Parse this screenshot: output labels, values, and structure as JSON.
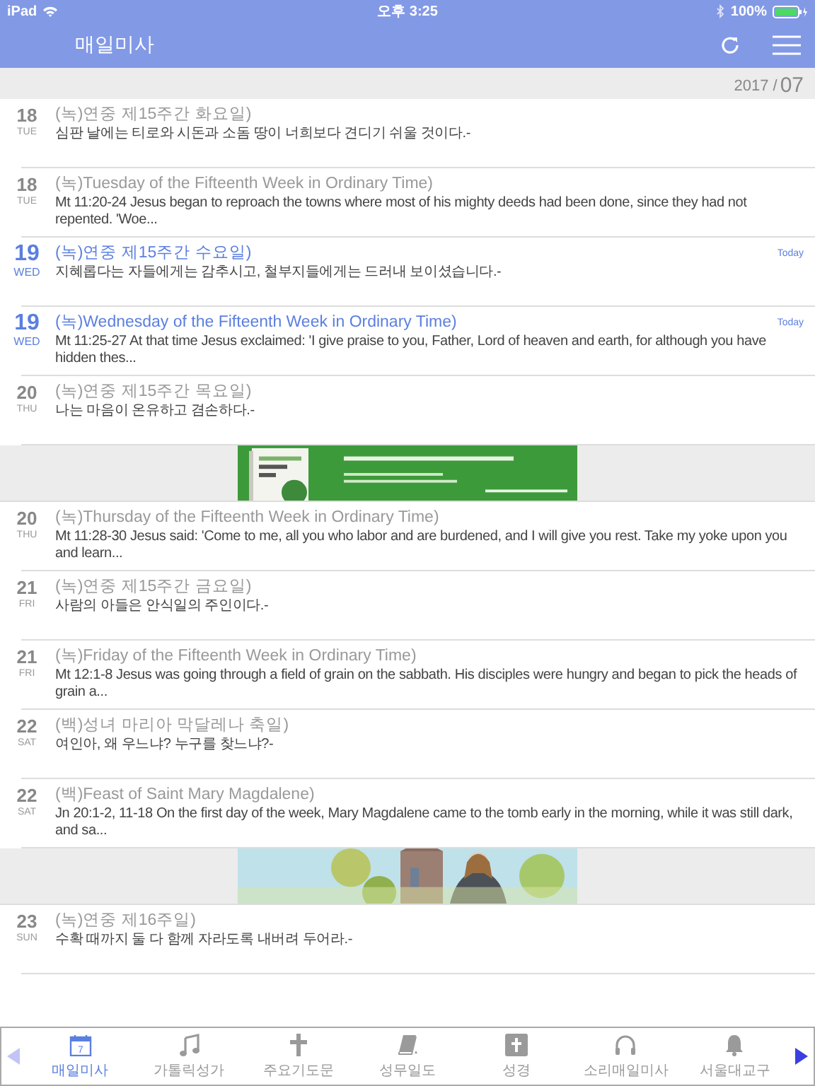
{
  "status_bar": {
    "device": "iPad",
    "time": "오후 3:25",
    "battery": "100%"
  },
  "nav": {
    "title": "매일미사"
  },
  "month_header": {
    "year": "2017 /",
    "month": "07"
  },
  "rows": [
    {
      "kind": "entry",
      "date": "18",
      "weekday": "TUE",
      "title": "(녹)연중 제15주간 화요일)",
      "snippet": "심판 날에는 티로와 시돈과 소돔 땅이 너희보다 견디기 쉬울 것이다.-",
      "today": false
    },
    {
      "kind": "entry",
      "date": "18",
      "weekday": "TUE",
      "title": "(녹)Tuesday of the Fifteenth Week in Ordinary Time)",
      "snippet": "Mt 11:20-24 Jesus began to reproach the towns where most of his mighty deeds had been done, since they had not repented. 'Woe...",
      "today": false
    },
    {
      "kind": "entry",
      "date": "19",
      "weekday": "WED",
      "title": "(녹)연중 제15주간 수요일)",
      "snippet": "지혜롭다는 자들에게는 감추시고, 철부지들에게는 드러내 보이셨습니다.-",
      "today": true,
      "badge": "Today"
    },
    {
      "kind": "entry",
      "date": "19",
      "weekday": "WED",
      "title": "(녹)Wednesday of the Fifteenth Week in Ordinary Time)",
      "snippet": "Mt 11:25-27 At that time Jesus exclaimed:  'I give praise to you, Father, Lord of heaven and earth, for although you have hidden thes...",
      "today": true,
      "badge": "Today"
    },
    {
      "kind": "entry",
      "date": "20",
      "weekday": "THU",
      "title": "(녹)연중 제15주간 목요일)",
      "snippet": "나는 마음이 온유하고 겸손하다.-",
      "today": false
    },
    {
      "kind": "ad"
    },
    {
      "kind": "entry",
      "date": "20",
      "weekday": "THU",
      "title": "(녹)Thursday of the Fifteenth Week in Ordinary Time)",
      "snippet": "Mt 11:28-30 Jesus said: 'Come to me, all you who labor and are burdened, and I will give you rest. Take my yoke upon you and learn...",
      "today": false
    },
    {
      "kind": "entry",
      "date": "21",
      "weekday": "FRI",
      "title": "(녹)연중 제15주간 금요일)",
      "snippet": "사람의 아들은 안식일의 주인이다.-",
      "today": false
    },
    {
      "kind": "entry",
      "date": "21",
      "weekday": "FRI",
      "title": "(녹)Friday of the Fifteenth Week in Ordinary Time)",
      "snippet": "Mt 12:1-8 Jesus was going through a field of grain on the sabbath. His disciples were hungry and began to pick the heads of grain a...",
      "today": false
    },
    {
      "kind": "entry",
      "date": "22",
      "weekday": "SAT",
      "title": "(백)성녀 마리아 막달레나 축일)",
      "snippet": "여인아, 왜 우느냐? 누구를 찾느냐?-",
      "today": false
    },
    {
      "kind": "entry",
      "date": "22",
      "weekday": "SAT",
      "title": "(백)Feast of Saint Mary Magdalene)",
      "snippet": "Jn 20:1-2, 11-18 On the first day of the week, Mary Magdalene came to the tomb early in the morning, while it was still dark, and sa...",
      "today": false
    },
    {
      "kind": "ad"
    },
    {
      "kind": "entry",
      "date": "23",
      "weekday": "SUN",
      "title": "(녹)연중 제16주일)",
      "snippet": "수확 때까지 둘 다 함께 자라도록 내버려 두어라.-",
      "today": false
    }
  ],
  "tab_bar": {
    "scroll_left": {
      "disabled": true
    },
    "scroll_right": {
      "disabled": false
    },
    "tabs": [
      {
        "label": "매일미사",
        "calendar_day": "7",
        "selected": true
      },
      {
        "label": "가톨릭성가",
        "selected": false
      },
      {
        "label": "주요기도문",
        "selected": false
      },
      {
        "label": "성무일도",
        "selected": false
      },
      {
        "label": "성경",
        "selected": false
      },
      {
        "label": "소리매일미사",
        "selected": false
      },
      {
        "label": "서울대교구",
        "selected": false
      }
    ]
  }
}
